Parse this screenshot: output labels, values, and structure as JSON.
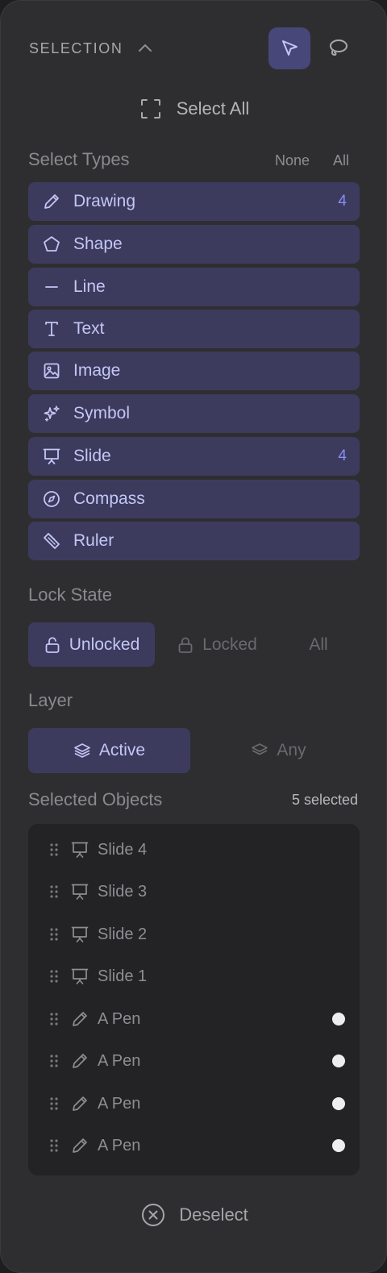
{
  "header": {
    "title": "SELECTION"
  },
  "select_all_label": "Select All",
  "select_types": {
    "label": "Select Types",
    "none_label": "None",
    "all_label": "All",
    "items": [
      {
        "label": "Drawing",
        "icon": "pencil-icon",
        "count": "4"
      },
      {
        "label": "Shape",
        "icon": "pentagon-icon",
        "count": ""
      },
      {
        "label": "Line",
        "icon": "line-icon",
        "count": ""
      },
      {
        "label": "Text",
        "icon": "text-icon",
        "count": ""
      },
      {
        "label": "Image",
        "icon": "image-icon",
        "count": ""
      },
      {
        "label": "Symbol",
        "icon": "sparkles-icon",
        "count": ""
      },
      {
        "label": "Slide",
        "icon": "presentation-icon",
        "count": "4"
      },
      {
        "label": "Compass",
        "icon": "compass-icon",
        "count": ""
      },
      {
        "label": "Ruler",
        "icon": "ruler-icon",
        "count": ""
      }
    ]
  },
  "lock_state": {
    "label": "Lock State",
    "options": {
      "unlocked": "Unlocked",
      "locked": "Locked",
      "all": "All"
    },
    "selected": "Unlocked"
  },
  "layer": {
    "label": "Layer",
    "options": {
      "active": "Active",
      "any": "Any"
    },
    "selected": "Active"
  },
  "selected_objects": {
    "label": "Selected Objects",
    "count_label": "5 selected",
    "items": [
      {
        "label": "Slide 4",
        "icon": "presentation-icon",
        "dot": false
      },
      {
        "label": "Slide 3",
        "icon": "presentation-icon",
        "dot": false
      },
      {
        "label": "Slide 2",
        "icon": "presentation-icon",
        "dot": false
      },
      {
        "label": "Slide 1",
        "icon": "presentation-icon",
        "dot": false
      },
      {
        "label": "A Pen",
        "icon": "pencil-icon",
        "dot": true
      },
      {
        "label": "A Pen",
        "icon": "pencil-icon",
        "dot": true
      },
      {
        "label": "A Pen",
        "icon": "pencil-icon",
        "dot": true
      },
      {
        "label": "A Pen",
        "icon": "pencil-icon",
        "dot": true
      }
    ]
  },
  "deselect_label": "Deselect",
  "colors": {
    "panel_bg": "#2e2e31",
    "accent": "#8a8df0",
    "active_bg": "#3c3b5e",
    "tool_active_bg": "#474779",
    "dot": "#eeeeef"
  }
}
